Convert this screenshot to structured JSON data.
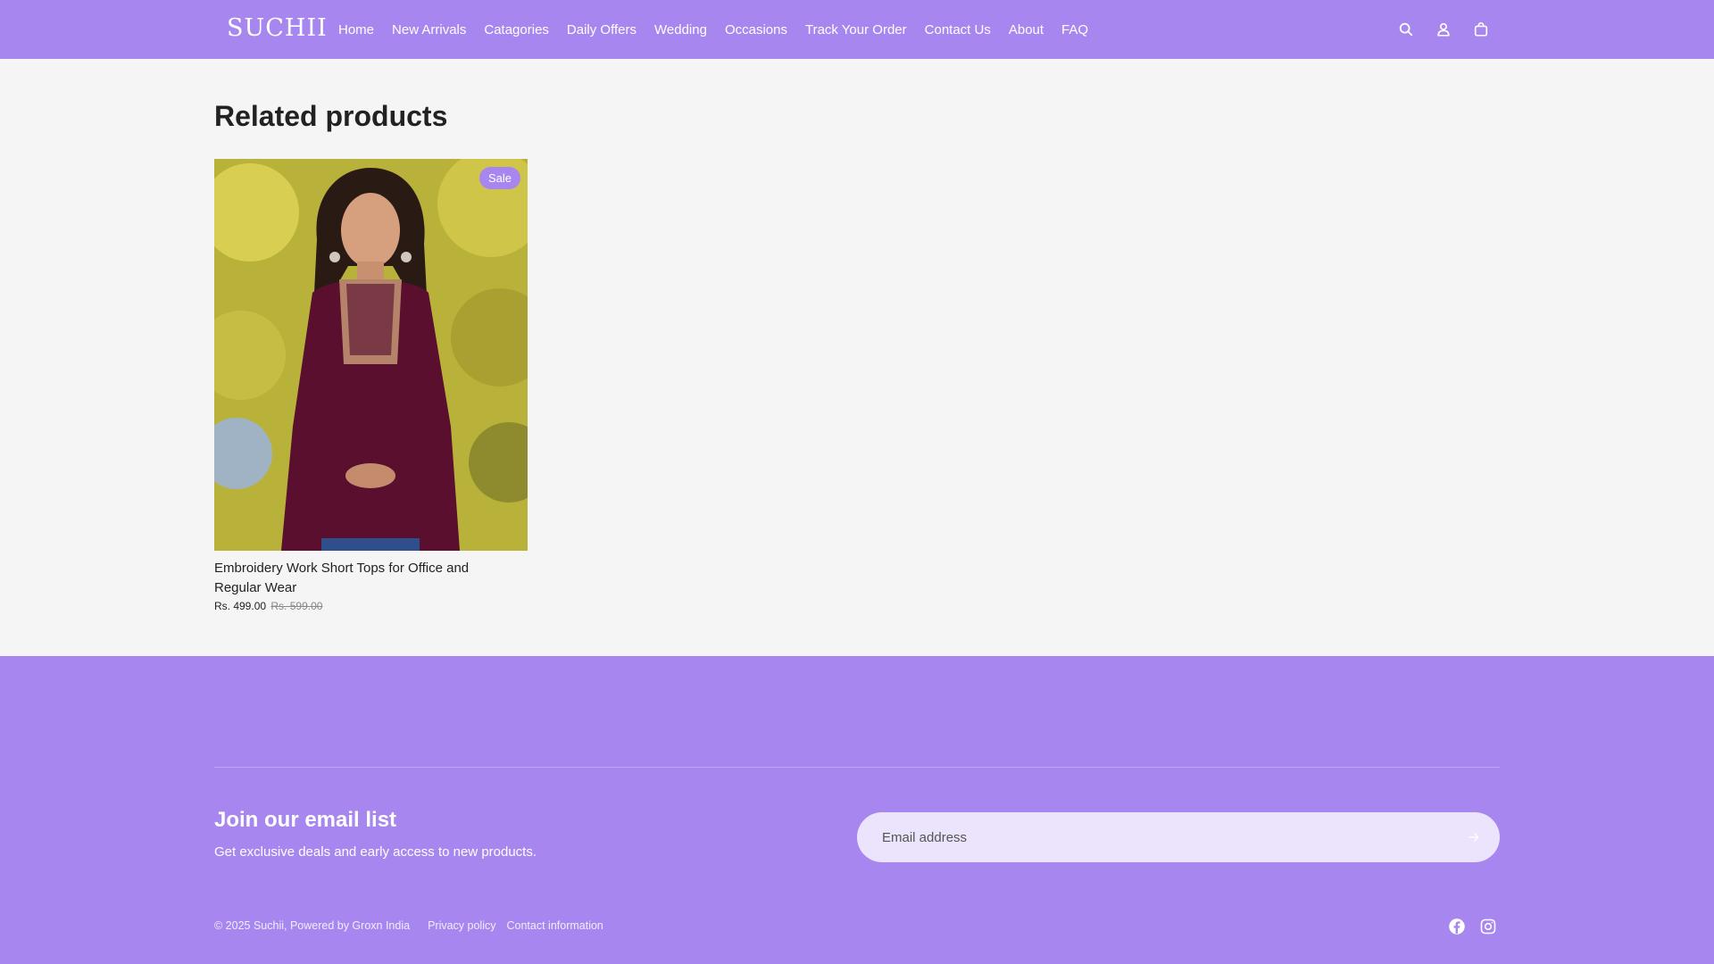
{
  "header": {
    "logo": "SUCHII",
    "nav": [
      "Home",
      "New Arrivals",
      "Catagories",
      "Daily Offers",
      "Wedding",
      "Occasions",
      "Track Your Order",
      "Contact Us",
      "About",
      "FAQ"
    ],
    "icons": [
      "search-icon",
      "account-icon",
      "cart-icon"
    ]
  },
  "main": {
    "section_title": "Related products",
    "products": [
      {
        "badge": "Sale",
        "title": "Embroidery Work Short Tops for Office and Regular Wear",
        "price": "Rs. 499.00",
        "compare_price": "Rs. 599.00"
      }
    ]
  },
  "footer": {
    "newsletter_title": "Join our email list",
    "newsletter_text": "Get exclusive deals and early access to new products.",
    "email_placeholder": "Email address",
    "copyright": "© 2025 Suchii, Powered by Groxn India",
    "links": [
      "Privacy policy",
      "Contact information"
    ],
    "social_icons": [
      "facebook-icon",
      "instagram-icon"
    ]
  },
  "colors": {
    "brand": "#a886ef",
    "background": "#f5f5f5",
    "email_field": "#ece4fc"
  }
}
